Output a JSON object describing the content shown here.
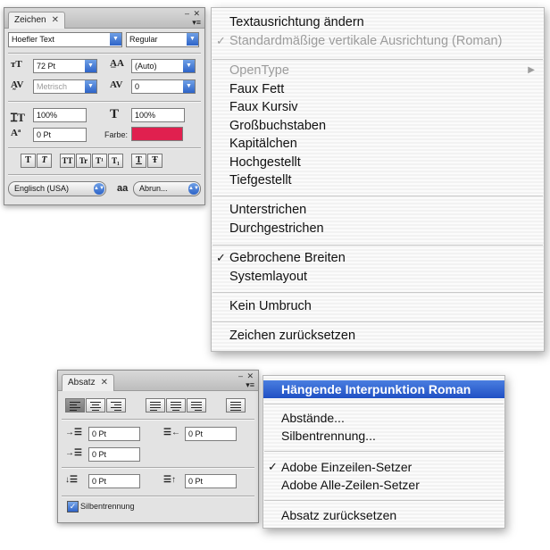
{
  "zeichen_panel": {
    "tab_label": "Zeichen",
    "tab_close": "✕",
    "window_controls": "‒ ✕",
    "font_family": "Hoefler Text",
    "font_style": "Regular",
    "size": "72 Pt",
    "leading": "(Auto)",
    "kerning": "Metrisch",
    "tracking": "0",
    "vertical_scale": "100%",
    "horizontal_scale": "100%",
    "baseline_shift": "0 Pt",
    "color_label": "Farbe:",
    "color_swatch": "#e0204f",
    "style_buttons": [
      "T",
      "T",
      "TT",
      "Tr",
      "T¹",
      "T₁",
      "T",
      "Ŧ"
    ],
    "language": "Englisch (USA)",
    "antialias_icon": "aa",
    "antialias": "Abrun..."
  },
  "zeichen_menu": {
    "items": [
      {
        "label": "Textausrichtung ändern",
        "checked": false,
        "disabled": false
      },
      {
        "label": "Standardmäßige vertikale Ausrichtung (Roman)",
        "checked": true,
        "disabled": true
      },
      {
        "label": "OpenType",
        "checked": false,
        "disabled": true,
        "submenu": true
      },
      {
        "label": "Faux Fett",
        "checked": false,
        "disabled": false
      },
      {
        "label": "Faux Kursiv",
        "checked": false,
        "disabled": false
      },
      {
        "label": "Großbuchstaben",
        "checked": false,
        "disabled": false
      },
      {
        "label": "Kapitälchen",
        "checked": false,
        "disabled": false
      },
      {
        "label": "Hochgestellt",
        "checked": false,
        "disabled": false
      },
      {
        "label": "Tiefgestellt",
        "checked": false,
        "disabled": false
      },
      {
        "label": "Unterstrichen",
        "checked": false,
        "disabled": false
      },
      {
        "label": "Durchgestrichen",
        "checked": false,
        "disabled": false
      },
      {
        "label": "Gebrochene Breiten",
        "checked": true,
        "disabled": false
      },
      {
        "label": "Systemlayout",
        "checked": false,
        "disabled": false
      },
      {
        "label": "Kein Umbruch",
        "checked": false,
        "disabled": false
      },
      {
        "label": "Zeichen zurücksetzen",
        "checked": false,
        "disabled": false
      }
    ],
    "check_glyph": "✓",
    "submenu_glyph": "▶"
  },
  "absatz_panel": {
    "tab_label": "Absatz",
    "tab_close": "✕",
    "window_controls": "‒ ✕",
    "left_indent": "0 Pt",
    "right_indent": "0 Pt",
    "first_line_indent": "0 Pt",
    "space_before": "0 Pt",
    "space_after": "0 Pt",
    "hyphenation_label": "Silbentrennung",
    "hyphenation_checked": true
  },
  "absatz_menu": {
    "items": [
      {
        "label": "Hängende Interpunktion Roman",
        "checked": false,
        "highlighted": true
      },
      {
        "label": "Abstände...",
        "checked": false,
        "highlighted": false
      },
      {
        "label": "Silbentrennung...",
        "checked": false,
        "highlighted": false
      },
      {
        "label": "Adobe Einzeilen-Setzer",
        "checked": true,
        "highlighted": false
      },
      {
        "label": "Adobe Alle-Zeilen-Setzer",
        "checked": false,
        "highlighted": false
      },
      {
        "label": "Absatz zurücksetzen",
        "checked": false,
        "highlighted": false
      }
    ],
    "check_glyph": "✓"
  }
}
